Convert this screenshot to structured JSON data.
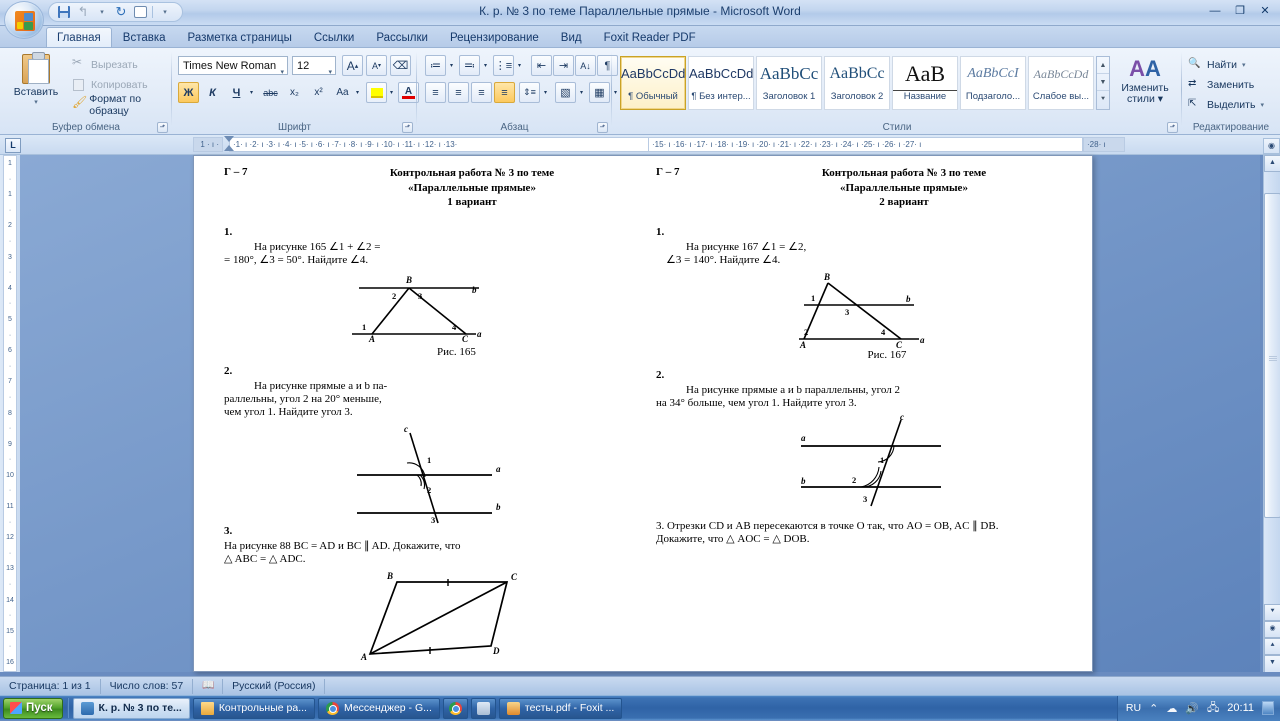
{
  "window": {
    "title": "К. р. № 3 по теме Параллельные прямые - Microsoft Word",
    "minimize": "—",
    "maximize": "❐",
    "close": "✕"
  },
  "quick_access": {
    "save": "save-icon",
    "undo": "↰",
    "undo_arrow": "▾",
    "redo": "↻",
    "print_preview": "print-preview-icon",
    "customize": "▾"
  },
  "tabs": [
    {
      "label": "Главная",
      "active": true
    },
    {
      "label": "Вставка",
      "active": false
    },
    {
      "label": "Разметка страницы",
      "active": false
    },
    {
      "label": "Ссылки",
      "active": false
    },
    {
      "label": "Рассылки",
      "active": false
    },
    {
      "label": "Рецензирование",
      "active": false
    },
    {
      "label": "Вид",
      "active": false
    },
    {
      "label": "Foxit Reader PDF",
      "active": false
    }
  ],
  "ribbon": {
    "clipboard": {
      "group_label": "Буфер обмена",
      "paste": "Вставить",
      "paste_arrow": "▾",
      "cut": "Вырезать",
      "copy": "Копировать",
      "format_painter": "Формат по образцу"
    },
    "font": {
      "group_label": "Шрифт",
      "font_name": "Times New Roman",
      "font_size": "12",
      "grow_font": "A",
      "shrink_font": "A",
      "clear_format": "clear-formatting-icon",
      "bold": "Ж",
      "italic": "К",
      "underline": "Ч",
      "underline_arrow": "▾",
      "strikethrough": "abc",
      "subscript": "x₂",
      "superscript": "x²",
      "change_case": "Aa",
      "change_case_arrow": "▾",
      "highlight": "highlight-icon",
      "highlight_arrow": "▾",
      "font_color": "A",
      "font_color_arrow": "▾"
    },
    "paragraph": {
      "group_label": "Абзац",
      "bullets": "bullets-icon",
      "numbering": "numbering-icon",
      "multilevel": "multilevel-list-icon",
      "decrease_indent": "decrease-indent-icon",
      "increase_indent": "increase-indent-icon",
      "sort": "sort-icon",
      "show_marks": "¶",
      "align_left": "align-left-icon",
      "align_center": "align-center-icon",
      "align_right": "align-right-icon",
      "justify": "justify-icon",
      "line_spacing": "line-spacing-icon",
      "shading": "shading-icon",
      "borders": "borders-icon"
    },
    "styles": {
      "group_label": "Стили",
      "items": [
        {
          "preview": "AaBbCcDd",
          "name": "¶ Обычный",
          "selected": true,
          "serif": false
        },
        {
          "preview": "AaBbCcDd",
          "name": "¶ Без интер...",
          "selected": false,
          "serif": false
        },
        {
          "preview": "AaBbCc",
          "name": "Заголовок 1",
          "selected": false,
          "serif": true
        },
        {
          "preview": "AaBbCc",
          "name": "Заголовок 2",
          "selected": false,
          "serif": true
        },
        {
          "preview": "АаВ",
          "name": "Название",
          "selected": false,
          "serif": true
        },
        {
          "preview": "AaBbCcI",
          "name": "Подзаголо...",
          "selected": false,
          "serif": true
        },
        {
          "preview": "AaBbCcDd",
          "name": "Слабое вы...",
          "selected": false,
          "serif": true
        }
      ],
      "change_styles": "Изменить",
      "change_styles_2": "стили ▾"
    },
    "editing": {
      "group_label": "Редактирование",
      "find": "Найти",
      "find_arrow": "▾",
      "replace": "Заменить",
      "select": "Выделить",
      "select_arrow": "▾"
    }
  },
  "rulers": {
    "tab_selector": "L",
    "horizontal_left": "1 · ı · ",
    "horizontal": "·1· ı ·2· ı ·3· ı ·4· ı ·5· ı ·6· ı ·7· ı ·8· ı ·9· ı ·10· ı ·11· ı ·12· ı ·13·",
    "horizontal_right": "·15· ı ·16· ı ·17· ı ·18· ı ·19· ı ·20· ı ·21· ı ·22· ı ·23· ı ·24· ı ·25· ı ·26· ı ·27· ı",
    "horizontal_far_right": "·28· ı",
    "vertical": [
      "1",
      "·",
      "1",
      "·",
      "2",
      "·",
      "3",
      "·",
      "4",
      "·",
      "5",
      "·",
      "6",
      "·",
      "7",
      "·",
      "8",
      "·",
      "9",
      "·",
      "10",
      "·",
      "11",
      "·",
      "12",
      "·",
      "13",
      "·",
      "14",
      "·",
      "15",
      "·",
      "16"
    ]
  },
  "document": {
    "variant1": {
      "code": "Г – 7",
      "title_line1": "Контрольная работа № 3 по теме",
      "title_line2": "«Параллельные прямые»",
      "title_line3": "1 вариант",
      "task1_num": "1.",
      "task1_line1": "На  рисунке  165   ∠1 + ∠2 =",
      "task1_line2": "= 180°, ∠3 = 50°. Найдите ∠4.",
      "fig1_caption": "Рис. 165",
      "fig1_labels": {
        "B": "B",
        "A": "A",
        "C": "C",
        "a": "a",
        "b": "b",
        "1": "1",
        "2": "2",
        "3": "3",
        "4": "4"
      },
      "task2_num": "2.",
      "task2_line1": "На рисунке прямые a и b па-",
      "task2_line2": "раллельны, угол 2 на 20° меньше,",
      "task2_line3": "чем угол 1. Найдите угол 3.",
      "fig2_labels": {
        "a": "a",
        "b": "b",
        "c": "c",
        "1": "1",
        "2": "2",
        "3": "3"
      },
      "task3_num": "3.",
      "task3_line1": "На  рисунке  88  BC = AD  и  BC ∥ AD.  Докажите,  что",
      "task3_line2": "△ ABC = △ ADC.",
      "fig3_labels": {
        "A": "A",
        "B": "B",
        "C": "C",
        "D": "D"
      }
    },
    "variant2": {
      "code": "Г – 7",
      "title_line1": "Контрольная работа № 3 по теме",
      "title_line2": "«Параллельные прямые»",
      "title_line3": "2 вариант",
      "task1_num": "1.",
      "task1_line1": "На   рисунке   167   ∠1 = ∠2,",
      "task1_line2": "∠3 = 140°. Найдите ∠4.",
      "fig1_caption": "Рис. 167",
      "fig1_labels": {
        "B": "B",
        "A": "A",
        "C": "C",
        "a": "a",
        "b": "b",
        "1": "1",
        "2": "2",
        "3": "3",
        "4": "4"
      },
      "task2_num": "2.",
      "task2_line1": "На  рисунке  прямые  a  и  b  параллельны,  угол 2",
      "task2_line2": "на 34° больше, чем угол 1. Найдите угол 3.",
      "fig2_labels": {
        "a": "a",
        "b": "b",
        "c": "c",
        "1": "1",
        "2": "2",
        "3": "3"
      },
      "task3_line1": "3. Отрезки CD и AB пересекаются в точке O так, что AO = OB, AC ∥ DB.",
      "task3_line2": "Докажите, что △ AOC = △ DOB."
    }
  },
  "statusbar": {
    "page": "Страница: 1 из 1",
    "words": "Число слов: 57",
    "proof_icon": "proofing-icon",
    "language": "Русский (Россия)"
  },
  "taskbar": {
    "start": "Пуск",
    "items": [
      {
        "label": "К. р. № 3 по те...",
        "icon": "word-icon",
        "active": true
      },
      {
        "label": "Контрольные ра...",
        "icon": "folder-icon",
        "active": false
      },
      {
        "label": "Мессенджер - G...",
        "icon": "chrome-icon",
        "active": false
      },
      {
        "label": "",
        "icon": "chrome-icon",
        "active": false
      },
      {
        "label": "",
        "icon": "paint-icon",
        "active": false
      },
      {
        "label": "тесты.pdf - Foxit ...",
        "icon": "foxit-icon",
        "active": false
      }
    ],
    "tray": {
      "language": "RU",
      "show_hidden": "⌃",
      "cloud": "cloud-icon",
      "volume": "volume-icon",
      "network": "network-icon",
      "clock": "20:11",
      "show_desktop": "show-desktop-icon"
    }
  },
  "scrollbar": {
    "up": "▲",
    "down": "▼",
    "prev_page": "⯅",
    "select_browse": "◉",
    "next_page": "⯆",
    "select_browse_object": "select-browse-object-icon"
  },
  "colors": {
    "accent": "#2f63a6",
    "ribbon_bg": "#e3ecf8",
    "selected_style": "#c9a227",
    "page": "#ffffff"
  }
}
